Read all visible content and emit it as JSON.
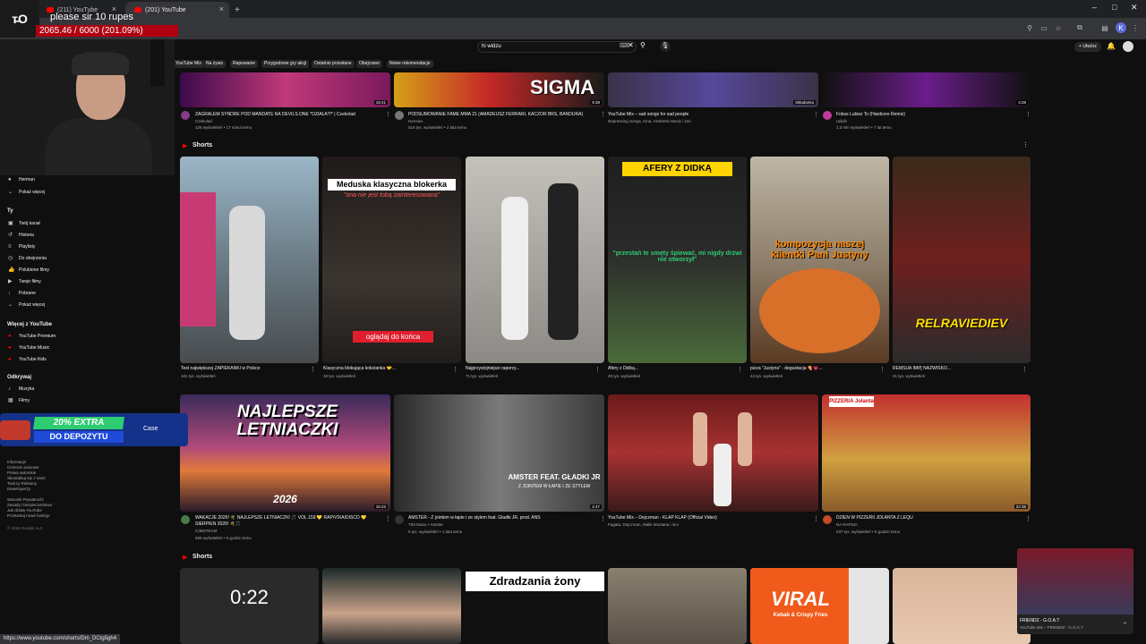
{
  "browser": {
    "tabs": [
      {
        "title": "(211) YouTube"
      },
      {
        "title": "(201) YouTube"
      }
    ],
    "new_tab_symbol": "+",
    "close_symbol": "×"
  },
  "overlay": {
    "donation_message": "please sir 10 rupes",
    "donation_progress": "2065.46 / 6000 (201.09%)",
    "donation_fill_fraction": 1.0,
    "logo_text": "ᴛ̶O"
  },
  "youtube": {
    "search_value": "hi widzu",
    "create_label": "Utwórz",
    "chips": [
      "YouTube Mix",
      "Na żywo",
      "Rapowanie",
      "Przygodowe gry akcji",
      "Ostatnio przesłane",
      "Obejrzane",
      "Nowe rekomendacje"
    ],
    "shorts_label": "Shorts",
    "shorts_label_2": "Shorts"
  },
  "sidebar": {
    "top_items": [
      {
        "label": "Herman"
      },
      {
        "label": "Pokaż więcej"
      }
    ],
    "you_header": "Ty",
    "you_items": [
      {
        "label": "Twój kanał"
      },
      {
        "label": "Historia"
      },
      {
        "label": "Playlisty"
      },
      {
        "label": "Do obejrzenia"
      },
      {
        "label": "Polubione filmy"
      },
      {
        "label": "Twoje filmy"
      },
      {
        "label": "Pobrane"
      },
      {
        "label": "Pokaż więcej"
      }
    ],
    "more_header": "Więcej z YouTube",
    "more_items": [
      {
        "label": "YouTube Premium"
      },
      {
        "label": "YouTube Music"
      },
      {
        "label": "YouTube Kids"
      }
    ],
    "explore_header": "Odkrywaj",
    "explore_items": [
      {
        "label": "Muzyka"
      },
      {
        "label": "Filmy"
      }
    ],
    "footer": [
      "Informacje",
      "Centrum prasowe",
      "Prawa autorskie",
      "Skontaktuj się z nami",
      "Twórcy   Reklamy",
      "Deweloperzy",
      "Warunki   Prywatność",
      "Zasady i bezpieczeństwo",
      "Jak działa YouTube",
      "Przetestuj nowe funkcje",
      "© 2026 Google LLC"
    ]
  },
  "top_row": [
    {
      "title": "ZAGRALEM SYNDRE POD MANDATE NA DEVILS.ONE *DZIAŁA?!* | Czekolad",
      "channel": "Czekolad",
      "meta": "126 wyświetleń • 17 minut temu",
      "duration": "18:41"
    },
    {
      "title": "PODSUMOWANIE FAME MMA 21 (AMADEUSZ FERRARI, KACZOR BRS, BANDURA)",
      "channel": "Herman",
      "meta": "518 tys. wyświetleń • 2 lata temu",
      "duration": "9:38",
      "thumb_text": "SIGMA"
    },
    {
      "title": "YouTube Mix – sad songs for sad people",
      "channel": "Depressing Songs, Kina, Aesthetic Music i inni",
      "meta": "",
      "duration": "Składanka"
    },
    {
      "title": "Fokus Lubisz To (Hardcore Remix)",
      "channel": "railofx",
      "meta": "2,3 mln wyświetleń • 7 lat temu",
      "duration": "4:28"
    }
  ],
  "shorts_row": [
    {
      "title": "Test największej ZAPIEKANKI w Polsce",
      "views": "181 tys. wyświetleń",
      "thumb_text": "",
      "color": "#6b7c86"
    },
    {
      "title": "Klasyczna blokująca koleżanka 🤝...",
      "views": "19 tys. wyświetleń",
      "thumb_text": "Meduska klasyczna blokerka",
      "thumb_sub": "\"ona nie jest tobą zainteresowana\"",
      "thumb_bottom": "oglądaj do końca",
      "color": "#3b3530"
    },
    {
      "title": "Najprzystojniejszi raperzy...",
      "views": "71 tys. wyświetleń",
      "thumb_text": "",
      "color": "#8d8a86"
    },
    {
      "title": "Afery z Didką...",
      "views": "29 tys. wyświetleń",
      "thumb_text": "AFERY Z DIDKĄ",
      "thumb_sub": "\"przestań te smęty śpiewać, mi nigdy drzwi nie otworzył\"",
      "color": "#2a2a2a"
    },
    {
      "title": "pizza \"Justyna\" - degustacja 🍕💗...",
      "views": "44 tys. wyświetleń",
      "thumb_text": "kompozycja naszej klientki Pani Justyny",
      "color": "#8a7a66"
    },
    {
      "title": "REMSUA IMIĘ NAZWISKO...",
      "views": "21 tys. wyświetleń",
      "thumb_text": "RELRAVIEDIEV",
      "color": "#6e1f1f"
    }
  ],
  "video_row": [
    {
      "title": "WAKACJE 2026! 🌴 NAJLEPSZE LETNIACZKI 🎵 VOL.159 💛 RAP/VIXA/DISCO 💛",
      "title2": "SIERPIEŃ 2026! 🌴🎵",
      "channel": "C3BSTEAM",
      "meta": "556 wyświetleń • 6 godzin temu",
      "duration": "16:23",
      "thumb_text": "NAJLEPSZE LETNIACZKI",
      "thumb_year": "2026"
    },
    {
      "title": "AMSTER - Z jointem w łapie i ze stylem feat. Gladki JR. prod. ANS",
      "channel": "TIM Music • Amster",
      "meta": "5 tys. wyświetleń • 1 lata temu",
      "duration": "2:47",
      "thumb_text": "AMSTER FEAT. GŁADKI JR",
      "thumb_sub": "Z JOINTEM W ŁAPIE I ZE STYLEM"
    },
    {
      "title": "YouTube Mix – Dejczman - KLAP KLAP (Official Video)",
      "channel": "Fagata, Dejczman, Malik Montana i inni",
      "meta": "",
      "duration": ""
    },
    {
      "title": "DZIEŃ W PIZZERII JOLANTA Z LEQU",
      "channel": "NA NAPSIA",
      "meta": "237 tys. wyświetleń • 6 godzin temu",
      "duration": "22:38",
      "thumb_text": "PIZZERIA Jolanta"
    }
  ],
  "bottom_shorts": [
    {
      "thumb_text": "0:22"
    },
    {
      "thumb_text": ""
    },
    {
      "thumb_text": "Zdradzania żony"
    },
    {
      "thumb_text": ""
    },
    {
      "thumb_text": "VIRAL",
      "thumb_sub": "Kebab & Crispy Fries"
    },
    {
      "thumb_text": ""
    }
  ],
  "ad": {
    "badge": "20% EXTRA",
    "sub": "DO DEPOZYTU",
    "brand": "Case"
  },
  "miniplayer": {
    "title": "FRIENDZ - G.O.A.T",
    "subtitle": "YouTube Mix – FRIENDZ - G.O.A.T"
  },
  "status_url": "https://www.youtube.com/shorts/Dm_DCtg5gh4",
  "colors": {
    "yt_red": "#ff0000",
    "donation_bar": "#b00010",
    "ad_green": "#2ecc71",
    "ad_blue": "#1f4cd6"
  }
}
